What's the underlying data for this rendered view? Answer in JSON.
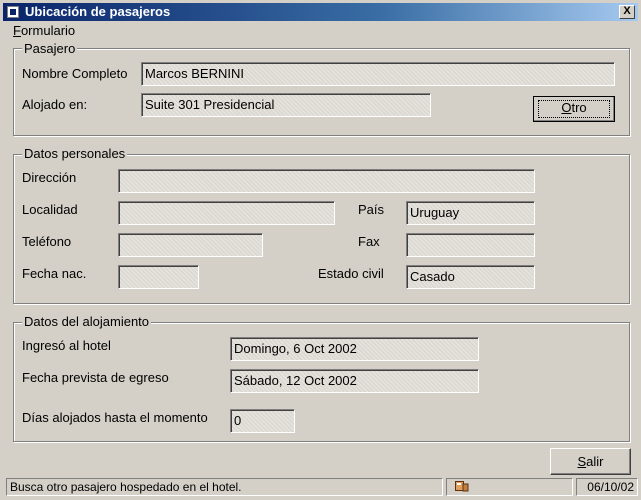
{
  "window": {
    "title": "Ubicación de pasajeros",
    "close_symbol": "X"
  },
  "menu": {
    "formulario": {
      "accel": "F",
      "rest": "ormulario"
    }
  },
  "pasajero": {
    "legend": "Pasajero",
    "nombre_label": "Nombre Completo",
    "nombre_value": "Marcos  BERNINI",
    "alojado_label": "Alojado en:",
    "alojado_value": "Suite 301 Presidencial",
    "otro_button": {
      "accel": "O",
      "rest": "tro"
    }
  },
  "datos_personales": {
    "legend": "Datos personales",
    "direccion_label": "Dirección",
    "direccion_value": "",
    "localidad_label": "Localidad",
    "localidad_value": "",
    "pais_label": "País",
    "pais_value": "Uruguay",
    "telefono_label": "Teléfono",
    "telefono_value": "",
    "fax_label": "Fax",
    "fax_value": "",
    "fecha_nac_label": "Fecha nac.",
    "fecha_nac_value": "",
    "estado_civil_label": "Estado civil",
    "estado_civil_value": "Casado"
  },
  "datos_alojamiento": {
    "legend": "Datos del alojamiento",
    "ingreso_label": "Ingresó al hotel",
    "ingreso_value": "Domingo, 6 Oct 2002",
    "egreso_label": "Fecha prevista de egreso",
    "egreso_value": "Sábado, 12 Oct 2002",
    "dias_label": "Días alojados hasta el momento",
    "dias_value": "0"
  },
  "salir_button": {
    "accel": "S",
    "rest": "alir"
  },
  "status": {
    "message": "Busca otro pasajero hospedado en el hotel.",
    "icon": "key-icon",
    "date": "06/10/02"
  }
}
